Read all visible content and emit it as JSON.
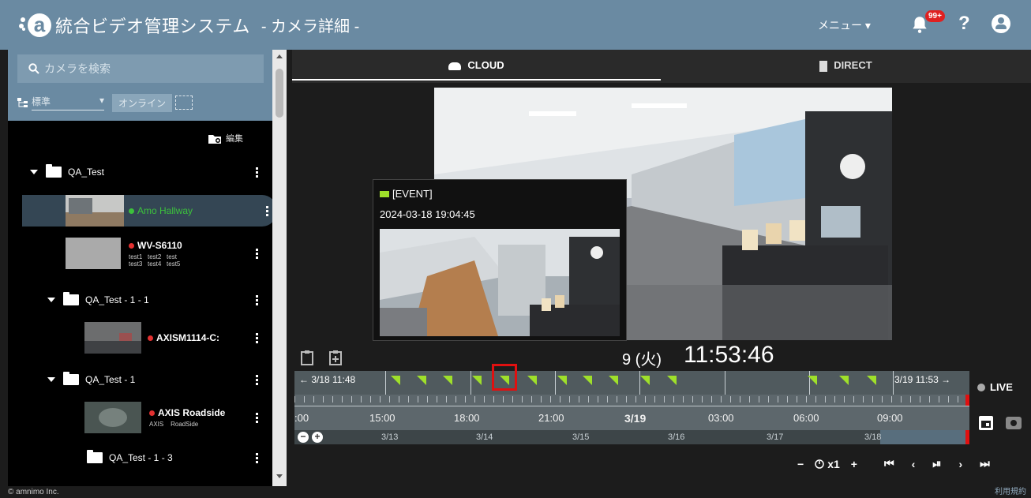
{
  "header": {
    "app_title": "統合ビデオ管理システム",
    "page_subtitle": "- カメラ詳細 -",
    "menu_label": "メニュー ▾",
    "notification_badge": "99+",
    "help_label": "?"
  },
  "sidebar": {
    "search_placeholder": "カメラを検索",
    "view_select": "標準",
    "online_label": "オンライン",
    "edit_label": "編集",
    "tree": [
      {
        "label": "QA_Test"
      },
      {
        "label": "Amo Hallway",
        "status": "online"
      },
      {
        "label": "WV-S6110",
        "status": "offline",
        "tags1": "test1   test2   test",
        "tags2": "test3   test4   test5"
      },
      {
        "label": "QA_Test - 1 - 1"
      },
      {
        "label": "AXISM1114-C:",
        "status": "offline"
      },
      {
        "label": "QA_Test - 1"
      },
      {
        "label": "AXIS Roadside",
        "status": "offline",
        "tags1": "AXIS    RoadSide"
      },
      {
        "label": "QA_Test - 1 - 3"
      }
    ]
  },
  "tabs": {
    "cloud": "CLOUD",
    "direct": "DIRECT"
  },
  "popup": {
    "title": "[EVENT]",
    "timestamp": "2024-03-18 19:04:45"
  },
  "datetime": {
    "date_fragment": "9 (火)",
    "time": "11:53:46"
  },
  "timeline": {
    "start_label": "← 3/18 11:48",
    "end_label": "3/19 11:53 →",
    "hours": [
      ":00",
      "15:00",
      "18:00",
      "21:00",
      "3/19",
      "03:00",
      "06:00",
      "09:00"
    ],
    "days": [
      "3/13",
      "3/14",
      "3/15",
      "3/16",
      "3/17",
      "3/18"
    ]
  },
  "live_label": "LIVE",
  "playback": {
    "speed": "x1"
  },
  "footer": {
    "copyright": "© amnimo Inc.",
    "terms": "利用規約"
  },
  "colors": {
    "header_bg": "#6a8aa2",
    "online": "#3cc13c",
    "offline": "#e23030",
    "event_flag": "#9fe02a",
    "highlight": "#e01010"
  }
}
